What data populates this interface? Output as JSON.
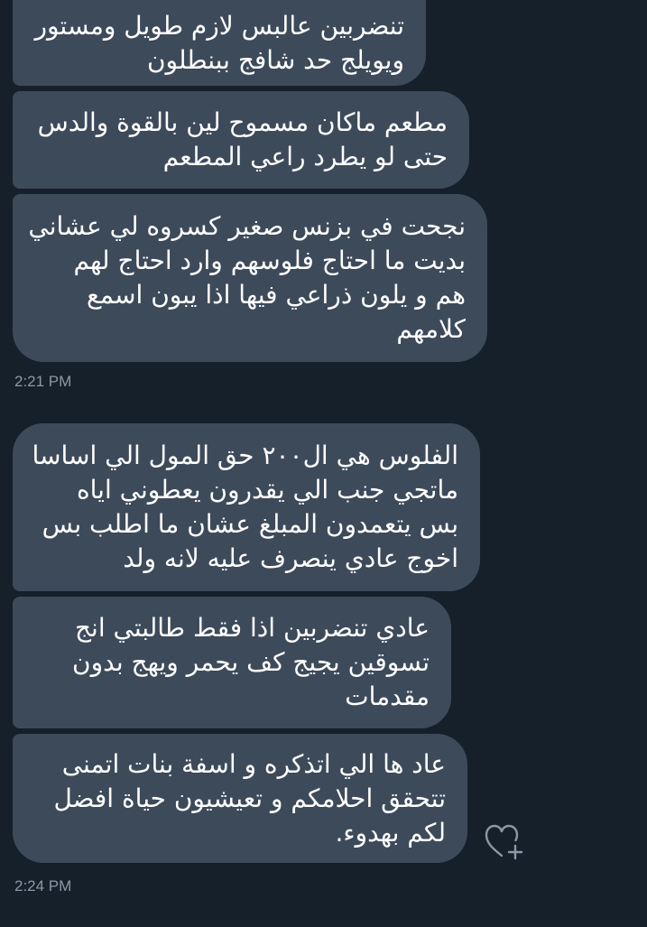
{
  "conversation": {
    "groups": [
      {
        "messages": [
          {
            "lines": [
              "تنضربين عالبس لازم طويل ومستور",
              "ويويلج حد شافج ببنطلون"
            ]
          },
          {
            "lines": [
              "مطعم ماكان مسموح لين بالقوة والدس",
              "حتى لو يطرد راعي المطعم"
            ]
          },
          {
            "lines": [
              "نجحت في بزنس صغير كسروه لي عشاني",
              "بديت ما احتاج فلوسهم وارد احتاج لهم",
              "هم و يلون ذراعي فيها اذا يبون اسمع",
              "كلامهم"
            ]
          }
        ],
        "timestamp": "2:21 PM"
      },
      {
        "messages": [
          {
            "lines": [
              "الفلوس هي ال٢٠٠ حق المول الي اساسا",
              "ماتجي جنب الي يقدرون يعطوني اياه",
              "بس يتعمدون المبلغ عشان ما اطلب بس",
              "اخوج عادي ينصرف عليه لانه ولد"
            ]
          },
          {
            "lines": [
              "عادي تنضربين اذا فقط طالبتي انج",
              "تسوقين يجيج كف يحمر ويهج بدون",
              "مقدمات"
            ]
          },
          {
            "lines": [
              "عاد ها الي اتذكره و اسفة بنات اتمنى",
              "تتحقق احلامكم و تعيشيون حياة افضل",
              "لكم بهدوء."
            ]
          }
        ],
        "timestamp": "2:24 PM"
      }
    ],
    "like_icon": "heart-plus-icon",
    "colors": {
      "background": "#15202b",
      "bubble": "#3d4a5a",
      "text": "#ffffff",
      "timestamp": "#8b98a5",
      "icon": "#8b98a5"
    }
  }
}
